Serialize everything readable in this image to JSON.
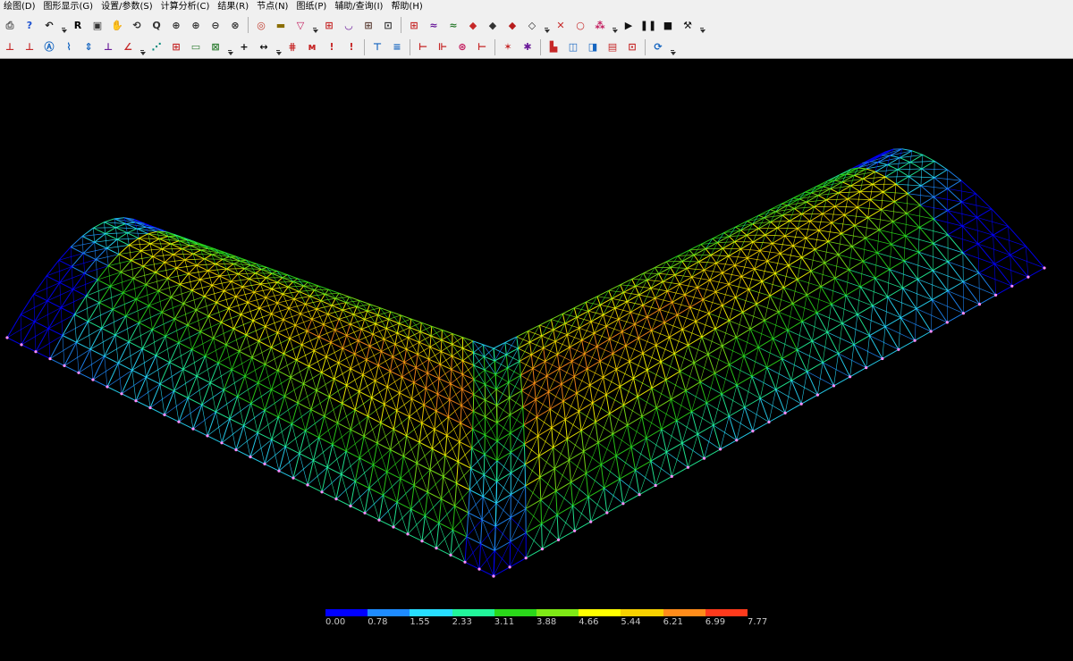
{
  "menu": [
    {
      "label": "绘图(D)"
    },
    {
      "label": "图形显示(G)"
    },
    {
      "label": "设置/参数(S)"
    },
    {
      "label": "计算分析(C)"
    },
    {
      "label": "结果(R)"
    },
    {
      "label": "节点(N)"
    },
    {
      "label": "图纸(P)"
    },
    {
      "label": "辅助/查询(I)"
    },
    {
      "label": "帮助(H)"
    }
  ],
  "toolbar1": [
    {
      "t": "btn",
      "name": "print-icon",
      "g": "⎙",
      "c": "#555"
    },
    {
      "t": "btn",
      "name": "help-icon",
      "g": "?",
      "c": "#1a4fd0"
    },
    {
      "t": "btn",
      "name": "undo-icon",
      "g": "↶",
      "c": "#222"
    },
    {
      "t": "grip"
    },
    {
      "t": "btn",
      "name": "redraw-icon",
      "g": "R",
      "c": "#000"
    },
    {
      "t": "btn",
      "name": "window-frame-icon",
      "g": "▣",
      "c": "#333"
    },
    {
      "t": "btn",
      "name": "pan-hand-icon",
      "g": "✋",
      "c": "#333"
    },
    {
      "t": "btn",
      "name": "rotate-view-icon",
      "g": "⟲",
      "c": "#333"
    },
    {
      "t": "btn",
      "name": "zoom-realtime-icon",
      "g": "Q",
      "c": "#333"
    },
    {
      "t": "btn",
      "name": "zoom-window-icon",
      "g": "⊕",
      "c": "#333"
    },
    {
      "t": "btn",
      "name": "zoom-in-icon",
      "g": "⊕",
      "c": "#333"
    },
    {
      "t": "btn",
      "name": "zoom-out-icon",
      "g": "⊖",
      "c": "#333"
    },
    {
      "t": "btn",
      "name": "zoom-extents-icon",
      "g": "⊗",
      "c": "#333"
    },
    {
      "t": "sep"
    },
    {
      "t": "btn",
      "name": "zoom-previous-icon",
      "g": "◎",
      "c": "#c0392b"
    },
    {
      "t": "btn",
      "name": "layer-icon",
      "g": "▬",
      "c": "#8a6d00"
    },
    {
      "t": "btn",
      "name": "filter-icon",
      "g": "▽",
      "c": "#c2185b"
    },
    {
      "t": "grip"
    },
    {
      "t": "btn",
      "name": "grid-view-icon",
      "g": "⊞",
      "c": "#c62828"
    },
    {
      "t": "btn",
      "name": "section-view-icon",
      "g": "◡",
      "c": "#6a1b9a"
    },
    {
      "t": "btn",
      "name": "frame-view-icon",
      "g": "⊞",
      "c": "#5d4037"
    },
    {
      "t": "btn",
      "name": "axis-view-icon",
      "g": "⊡",
      "c": "#333"
    },
    {
      "t": "sep"
    },
    {
      "t": "btn",
      "name": "plane-grid-icon",
      "g": "⊞",
      "c": "#c62828"
    },
    {
      "t": "btn",
      "name": "curve-draw-icon",
      "g": "≈",
      "c": "#6a1b9a"
    },
    {
      "t": "btn",
      "name": "curve-edit-icon",
      "g": "≈",
      "c": "#2e7d32"
    },
    {
      "t": "btn",
      "name": "solid-view-icon",
      "g": "◆",
      "c": "#c62828"
    },
    {
      "t": "btn",
      "name": "cube-view-icon",
      "g": "◆",
      "c": "#333"
    },
    {
      "t": "btn",
      "name": "cube-shaded-icon",
      "g": "◆",
      "c": "#b71c1c"
    },
    {
      "t": "btn",
      "name": "cube-wire-icon",
      "g": "◇",
      "c": "#333"
    },
    {
      "t": "grip"
    },
    {
      "t": "btn",
      "name": "delete-member-icon",
      "g": "✕",
      "c": "#c62828"
    },
    {
      "t": "btn",
      "name": "node-icon",
      "g": "○",
      "c": "#c62828"
    },
    {
      "t": "btn",
      "name": "color-dots-icon",
      "g": "⁂",
      "c": "#c2185b"
    },
    {
      "t": "grip"
    },
    {
      "t": "btn",
      "name": "play-icon",
      "g": "▶",
      "c": "#111"
    },
    {
      "t": "btn",
      "name": "pause-icon",
      "g": "❚❚",
      "c": "#111"
    },
    {
      "t": "btn",
      "name": "stop-icon",
      "g": "■",
      "c": "#111"
    },
    {
      "t": "btn",
      "name": "hammer-icon",
      "g": "⚒",
      "c": "#111"
    },
    {
      "t": "grip"
    }
  ],
  "toolbar2": [
    {
      "t": "btn",
      "name": "support-fixed-icon",
      "g": "⊥",
      "c": "#c62828"
    },
    {
      "t": "btn",
      "name": "support-delete-icon",
      "g": "⊥",
      "c": "#c62828"
    },
    {
      "t": "btn",
      "name": "support-hinge-icon",
      "g": "Ⓐ",
      "c": "#1565c0"
    },
    {
      "t": "btn",
      "name": "support-spring-icon",
      "g": "⌇",
      "c": "#1565c0"
    },
    {
      "t": "btn",
      "name": "support-roller-icon",
      "g": "⇕",
      "c": "#1565c0"
    },
    {
      "t": "btn",
      "name": "support-remove-icon",
      "g": "⊥",
      "c": "#6a1b9a"
    },
    {
      "t": "btn",
      "name": "support-slope-icon",
      "g": "∠",
      "c": "#c62828"
    },
    {
      "t": "grip"
    },
    {
      "t": "btn",
      "name": "load-node-icon",
      "g": "⋰",
      "c": "#00897b"
    },
    {
      "t": "btn",
      "name": "load-grid-icon",
      "g": "⊞",
      "c": "#c62828"
    },
    {
      "t": "btn",
      "name": "load-panel-icon",
      "g": "▭",
      "c": "#2e7d32"
    },
    {
      "t": "btn",
      "name": "load-check-icon",
      "g": "⊠",
      "c": "#2e7d32"
    },
    {
      "t": "grip"
    },
    {
      "t": "btn",
      "name": "add-cross-icon",
      "g": "+",
      "c": "#111"
    },
    {
      "t": "btn",
      "name": "dimension-icon",
      "g": "↔",
      "c": "#111"
    },
    {
      "t": "grip"
    },
    {
      "t": "btn",
      "name": "member-grid-icon",
      "g": "⋕",
      "c": "#c62828"
    },
    {
      "t": "btn",
      "name": "member-wave-icon",
      "g": "ᴍ",
      "c": "#c62828"
    },
    {
      "t": "btn",
      "name": "force-up-icon",
      "g": "!",
      "c": "#c62828"
    },
    {
      "t": "btn",
      "name": "force-down-icon",
      "g": "!",
      "c": "#c62828"
    },
    {
      "t": "sep"
    },
    {
      "t": "btn",
      "name": "beam-load-icon",
      "g": "⊤",
      "c": "#1565c0"
    },
    {
      "t": "btn",
      "name": "list-icon",
      "g": "≡",
      "c": "#1565c0"
    },
    {
      "t": "sep"
    },
    {
      "t": "btn",
      "name": "member-force-icon",
      "g": "⊢",
      "c": "#c62828"
    },
    {
      "t": "btn",
      "name": "member-axial-icon",
      "g": "⊩",
      "c": "#c62828"
    },
    {
      "t": "btn",
      "name": "node-check-icon",
      "g": "⊛",
      "c": "#c2185b"
    },
    {
      "t": "btn",
      "name": "node-stress-icon",
      "g": "⊢",
      "c": "#c62828"
    },
    {
      "t": "sep"
    },
    {
      "t": "btn",
      "name": "star-node-icon",
      "g": "✶",
      "c": "#c62828"
    },
    {
      "t": "btn",
      "name": "bug-icon",
      "g": "✱",
      "c": "#6a1b9a"
    },
    {
      "t": "sep"
    },
    {
      "t": "btn",
      "name": "bar-chart-icon",
      "g": "▙",
      "c": "#c62828"
    },
    {
      "t": "btn",
      "name": "window-a-icon",
      "g": "◫",
      "c": "#1565c0"
    },
    {
      "t": "btn",
      "name": "window-b-icon",
      "g": "◨",
      "c": "#1565c0"
    },
    {
      "t": "btn",
      "name": "window-c-icon",
      "g": "▤",
      "c": "#c62828"
    },
    {
      "t": "btn",
      "name": "window-d-icon",
      "g": "⊡",
      "c": "#c62828"
    },
    {
      "t": "sep"
    },
    {
      "t": "btn",
      "name": "refresh-icon",
      "g": "⟳",
      "c": "#1565c0"
    },
    {
      "t": "grip"
    }
  ],
  "legend": {
    "labels": [
      "0.00",
      "0.78",
      "1.55",
      "2.33",
      "3.11",
      "3.88",
      "4.66",
      "5.44",
      "6.21",
      "6.99",
      "7.77"
    ],
    "colors": [
      "#0000ff",
      "#1e8bff",
      "#27ddff",
      "#21f59a",
      "#2ad81a",
      "#7fea16",
      "#ffff00",
      "#f7d100",
      "#ff8c1a",
      "#ff3a1c"
    ]
  }
}
